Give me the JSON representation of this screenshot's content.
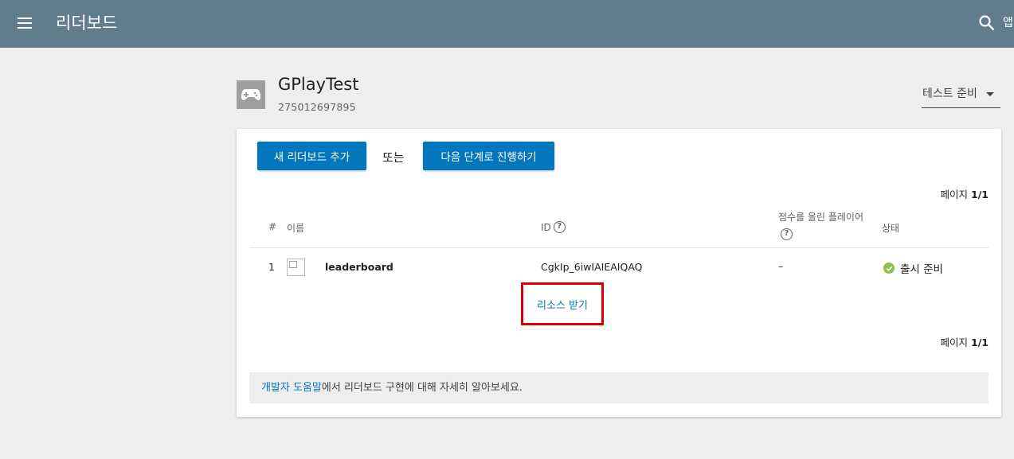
{
  "header": {
    "title": "리더보드",
    "apps_label": "앱"
  },
  "game": {
    "name": "GPlayTest",
    "id": "275012697895",
    "status_select": "테스트 준비"
  },
  "actions": {
    "add_button": "새 리더보드 추가",
    "or_text": "또는",
    "next_button": "다음 단계로 진행하기"
  },
  "pager": {
    "label": "페이지",
    "value": "1/1"
  },
  "table": {
    "columns": {
      "hash": "#",
      "name": "이름",
      "id": "ID",
      "players": "점수를 올린 플레이어",
      "state": "상태"
    },
    "rows": [
      {
        "num": "1",
        "name": "leaderboard",
        "id": "CgkIp_6iwIAIEAIQAQ",
        "players": "–",
        "state": "출시 준비"
      }
    ]
  },
  "resources_link": "리소스 받기",
  "help_banner": {
    "link": "개발자 도움말",
    "text": "에서 리더보드 구현에 대해 자세히 알아보세요."
  },
  "colors": {
    "topbar": "#607d8b",
    "primary_button": "#0277bd",
    "highlight_border": "#d50000",
    "ready_status": "#8bc34a"
  }
}
